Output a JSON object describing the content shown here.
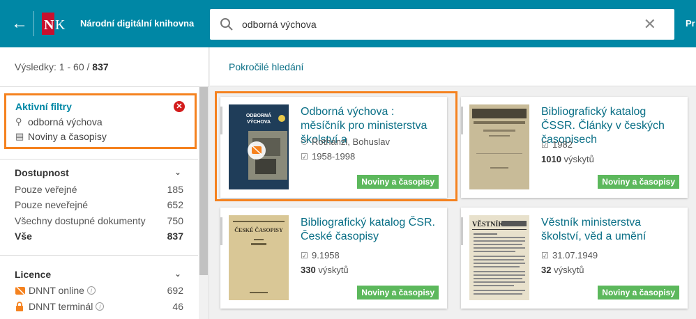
{
  "header": {
    "brand": "Národní digitální knihovna",
    "search_value": "odborná výchova",
    "more_label": "Pr"
  },
  "sidebar": {
    "results_prefix": "Výsledky: 1 - 60 / ",
    "results_total": "837",
    "active_filters": {
      "title": "Aktivní filtry",
      "items": [
        "odborná výchova",
        "Noviny a časopisy"
      ]
    },
    "availability": {
      "title": "Dostupnost",
      "items": [
        {
          "label": "Pouze veřejné",
          "count": "185"
        },
        {
          "label": "Pouze neveřejné",
          "count": "652"
        },
        {
          "label": "Všechny dostupné dokumenty",
          "count": "750"
        },
        {
          "label": "Vše",
          "count": "837"
        }
      ]
    },
    "license": {
      "title": "Licence",
      "items": [
        {
          "label": "DNNT online",
          "count": "692"
        },
        {
          "label": "DNNT terminál",
          "count": "46"
        }
      ]
    }
  },
  "main": {
    "advanced_search": "Pokročilé hledání",
    "cards": [
      {
        "title": "Odborná výchova : měsíčník pro ministerstva školství a",
        "author": "Rothanzl, Bohuslav",
        "date": "1958-1998",
        "tag": "Noviny a časopisy",
        "cover_text": "ODBORNÁ VÝCHOVA"
      },
      {
        "title": "Bibliografický katalog ČSSR. Články v českých časopisech",
        "date": "1982",
        "hits_count": "1010",
        "hits_label": " výskytů",
        "tag": "Noviny a časopisy"
      },
      {
        "title": "Bibliografický katalog ČSR. České časopisy",
        "date": "9.1958",
        "hits_count": "330",
        "hits_label": " výskytů",
        "tag": "Noviny a časopisy",
        "cover_text": "ČESKÉ ČASOPISY"
      },
      {
        "title": "Věstník ministerstva školství, věd a umění",
        "date": "31.07.1949",
        "hits_count": "32",
        "hits_label": " výskytů",
        "tag": "Noviny a časopisy",
        "cover_text": "VĚSTNÍK"
      }
    ]
  },
  "colors": {
    "brand": "#0087a5",
    "highlight": "#f5821f",
    "tag": "#5cb85c",
    "link": "#0a6f86"
  }
}
